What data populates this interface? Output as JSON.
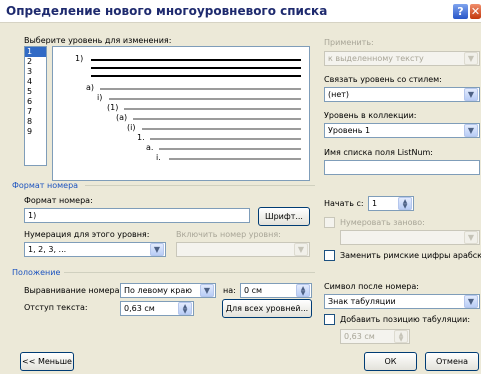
{
  "dialog": {
    "title": "Определение нового многоуровневого списка",
    "help_glyph": "?",
    "close_glyph": "✕"
  },
  "level": {
    "label": "Выберите уровень для изменения:",
    "items": [
      "1",
      "2",
      "3",
      "4",
      "5",
      "6",
      "7",
      "8",
      "9"
    ],
    "selected": "1"
  },
  "preview": {
    "labels": [
      "1)",
      "a)",
      "i)",
      "(1)",
      "(a)",
      "(i)",
      "1.",
      "a.",
      "i."
    ]
  },
  "apply": {
    "label": "Применить:",
    "value": "к выделенному тексту"
  },
  "link_style": {
    "label": "Связать уровень со стилем:",
    "value": "(нет)"
  },
  "gallery_level": {
    "label": "Уровень в коллекции:",
    "value": "Уровень 1"
  },
  "listnum": {
    "label": "Имя списка поля ListNum:",
    "value": ""
  },
  "number_format": {
    "section": "Формат номера",
    "format_label": "Формат номера:",
    "format_value": "1)",
    "font_button": "Шрифт...",
    "style_label": "Нумерация для этого уровня:",
    "style_value": "1, 2, 3, ...",
    "include_label": "Включить номер уровня:",
    "include_value": "",
    "start_label": "Начать с:",
    "start_value": "1",
    "restart_label": "Нумеровать заново:",
    "restart_value": "",
    "legal_label": "Заменить римские цифры арабскими"
  },
  "position": {
    "section": "Положение",
    "align_label": "Выравнивание номера:",
    "align_value": "По левому краю",
    "at_label": "на:",
    "at_value": "0 см",
    "indent_label": "Отступ текста:",
    "indent_value": "0,63 см",
    "all_levels_button": "Для всех уровней...",
    "follow_label": "Символ после номера:",
    "follow_value": "Знак табуляции",
    "tab_label": "Добавить позицию табуляции:",
    "tab_value": "0,63 см"
  },
  "footer": {
    "less_button": "<< Меньше",
    "ok_button": "ОК",
    "cancel_button": "Отмена"
  },
  "icons": {
    "dropdown": "▼",
    "spin_up": "▲",
    "spin_down": "▼"
  },
  "colors": {
    "title": "#1e2a6e",
    "section": "#1c53bf",
    "selection": "#316ac5",
    "dialog_bg": "#ece9d8"
  }
}
